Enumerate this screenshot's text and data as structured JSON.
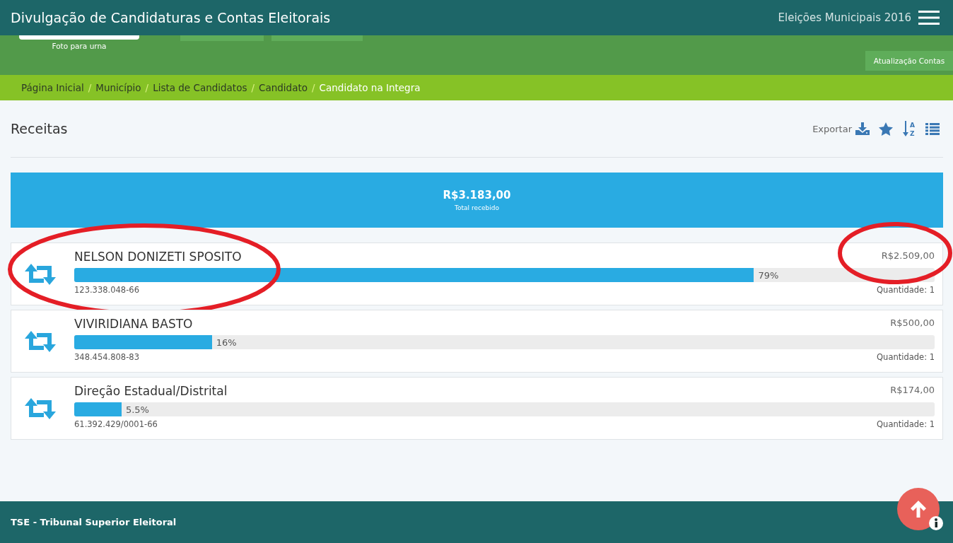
{
  "header": {
    "title": "Divulgação de Candidaturas e Contas Eleitorais",
    "election": "Eleições Municipais 2016"
  },
  "profile_band": {
    "photo_caption": "Foto para urna",
    "update_tab": "Atualização Contas"
  },
  "breadcrumb": [
    {
      "label": "Página Inicial",
      "selected": false
    },
    {
      "label": "Município",
      "selected": false
    },
    {
      "label": "Lista de Candidatos",
      "selected": false
    },
    {
      "label": "Candidato",
      "selected": false
    },
    {
      "label": "Candidato na Integra",
      "selected": true
    }
  ],
  "breadcrumb_separator": "/",
  "section": {
    "title": "Receitas",
    "export_label": "Exportar",
    "sort_letters": [
      "A",
      "Z"
    ]
  },
  "total": {
    "amount": "R$3.183,00",
    "caption": "Total recebido"
  },
  "receipts": [
    {
      "name": "NELSON DONIZETI SPOSITO",
      "document": "123.338.048-66",
      "amount": "R$2.509,00",
      "quantity": "Quantidade: 1",
      "level": 0.79,
      "percent": "79%",
      "circled": true
    },
    {
      "name": "VIVIRIDIANA BASTO",
      "document": "348.454.808-83",
      "amount": "R$500,00",
      "quantity": "Quantidade: 1",
      "level": 0.16,
      "percent": "16%",
      "circled": false
    },
    {
      "name": "Direção Estadual/Distrital",
      "document": "61.392.429/0001-66",
      "amount": "R$174,00",
      "quantity": "Quantidade: 1",
      "level": 0.055,
      "percent": "5.5%",
      "circled": false
    }
  ],
  "footer": {
    "text": "TSE - Tribunal Superior Eleitoral"
  }
}
